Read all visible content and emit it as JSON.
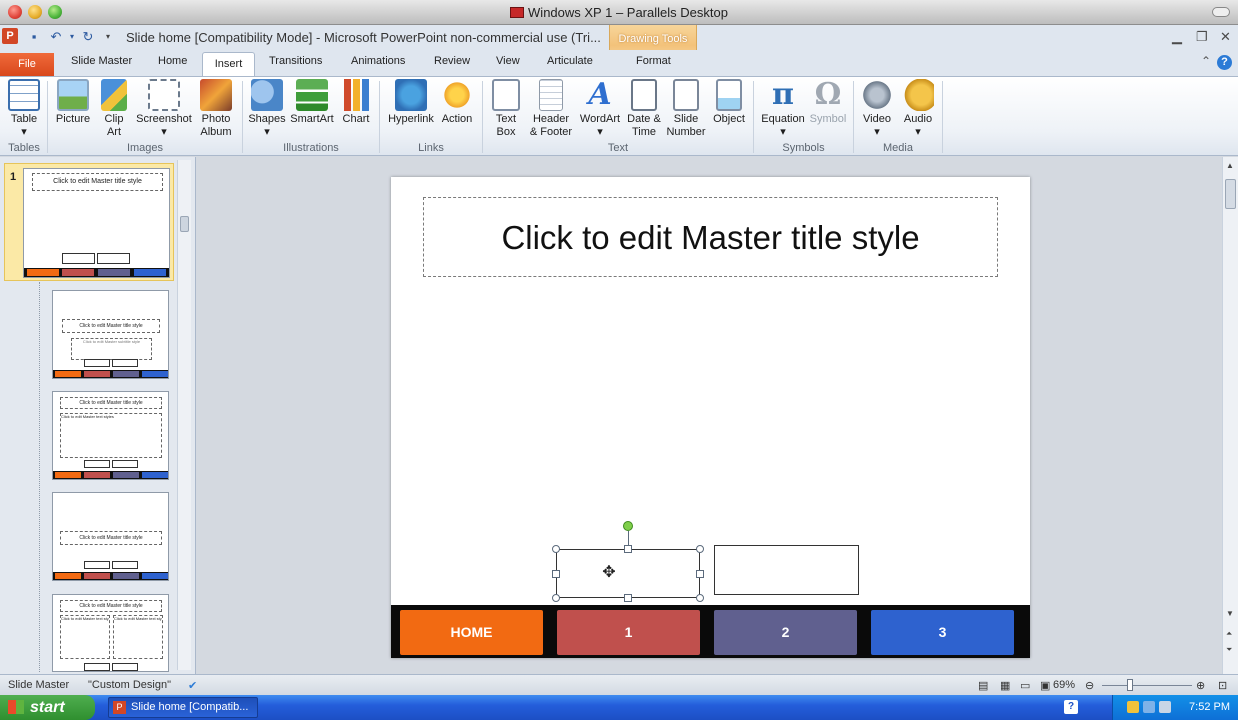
{
  "host": {
    "title": "Windows XP 1 – Parallels Desktop"
  },
  "app": {
    "logo": "P",
    "title": "Slide home [Compatibility Mode]  -  Microsoft PowerPoint non-commercial use (Tri...",
    "context_group": "Drawing Tools",
    "context_tab": "Format"
  },
  "tabs": {
    "file": "File",
    "items": [
      "Slide Master",
      "Home",
      "Insert",
      "Transitions",
      "Animations",
      "Review",
      "View",
      "Articulate"
    ],
    "active": "Insert"
  },
  "ribbon": {
    "buttons": {
      "table": "Table",
      "picture": "Picture",
      "clip_art": "Clip Art",
      "screenshot": "Screenshot",
      "photo_album": "Photo Album",
      "shapes": "Shapes",
      "smartart": "SmartArt",
      "chart": "Chart",
      "hyperlink": "Hyperlink",
      "action": "Action",
      "text_box": "Text Box",
      "header_footer": "Header & Footer",
      "wordart": "WordArt",
      "date_time": "Date & Time",
      "slide_number": "Slide Number",
      "object": "Object",
      "equation": "Equation",
      "symbol": "Symbol",
      "video": "Video",
      "audio": "Audio"
    },
    "groups": {
      "tables": "Tables",
      "images": "Images",
      "illustrations": "Illustrations",
      "links": "Links",
      "text": "Text",
      "symbols": "Symbols",
      "media": "Media"
    }
  },
  "thumbnails": {
    "selected_number": "1",
    "master_title": "Click to edit Master title style",
    "subtitle_hint": "Click to edit Master subtitle style",
    "text_hint": "Click to edit Master text styles"
  },
  "slide": {
    "title_placeholder": "Click to edit Master title style",
    "nav": [
      {
        "label": "HOME",
        "color": "#f26a12"
      },
      {
        "label": "1",
        "color": "#c0504d"
      },
      {
        "label": "2",
        "color": "#60608f"
      },
      {
        "label": "3",
        "color": "#2e62cf"
      }
    ]
  },
  "status": {
    "view": "Slide Master",
    "theme": "\"Custom Design\"",
    "zoom": "69%"
  },
  "taskbar": {
    "start": "start",
    "task": "Slide home [Compatib...",
    "time": "7:52 PM"
  }
}
